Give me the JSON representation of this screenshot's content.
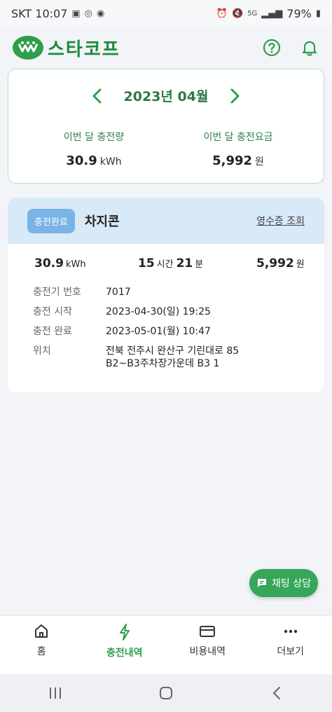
{
  "status_bar": {
    "carrier_time": "SKT 10:07",
    "battery": "79%",
    "network": "5G"
  },
  "header": {
    "brand": "스타코프"
  },
  "month_summary": {
    "month_label": "2023년 04월",
    "energy_label": "이번 달 충전량",
    "energy_value": "30.9",
    "energy_unit": "kWh",
    "fee_label": "이번 달 충전요금",
    "fee_value": "5,992",
    "fee_unit": "원"
  },
  "record": {
    "badge": "충전완료",
    "station": "차지콘",
    "receipt_link": "영수증 조회",
    "energy_value": "30.9",
    "energy_unit": "kWh",
    "hours_value": "15",
    "hours_unit": "시간",
    "minutes_value": "21",
    "minutes_unit": "분",
    "fee_value": "5,992",
    "fee_unit": "원",
    "details": [
      {
        "key": "충전기 번호",
        "value": "7017"
      },
      {
        "key": "충전 시작",
        "value": "2023-04-30(일) 19:25"
      },
      {
        "key": "충전 완료",
        "value": "2023-05-01(월) 10:47"
      },
      {
        "key": "위치",
        "value": "전북 전주시 완산구 기린대로 85",
        "value2": "B2~B3주차장가운데 B3 1"
      }
    ]
  },
  "chat_button": "채팅 상담",
  "bottom_nav": [
    {
      "label": "홈",
      "icon": "home-icon"
    },
    {
      "label": "충전내역",
      "icon": "bolt-icon"
    },
    {
      "label": "비용내역",
      "icon": "card-icon"
    },
    {
      "label": "더보기",
      "icon": "more-icon"
    }
  ],
  "colors": {
    "accent_green": "#2e9e4b",
    "badge_blue": "#7ab3e6",
    "record_header": "#d8e9f7"
  }
}
